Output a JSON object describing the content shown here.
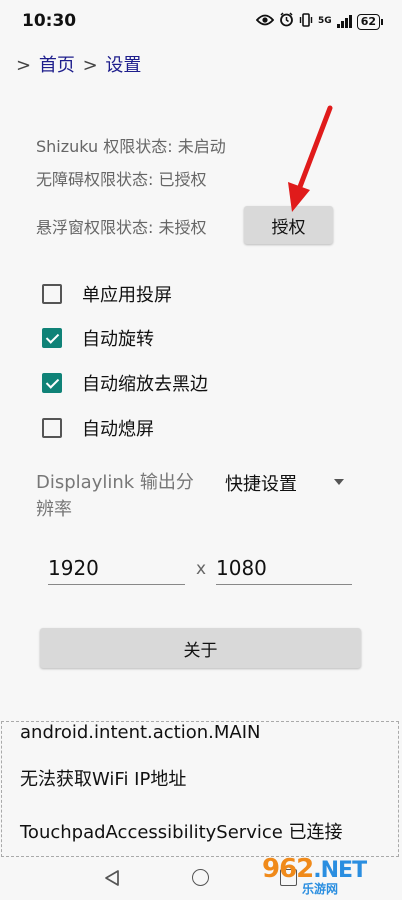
{
  "status_bar": {
    "time": "10:30",
    "network": "5G",
    "battery": "62",
    "icons": [
      "eye-icon",
      "alarm-icon",
      "vibrate-icon",
      "signal-icon",
      "battery-icon"
    ]
  },
  "breadcrumb": {
    "separator": ">",
    "home": "首页",
    "current": "设置"
  },
  "permissions": {
    "shizuku": "Shizuku 权限状态: 未启动",
    "accessibility": "无障碍权限状态: 已授权",
    "overlay": "悬浮窗权限状态: 未授权",
    "grant_label": "授权"
  },
  "options": [
    {
      "label": "单应用投屏",
      "checked": false
    },
    {
      "label": "自动旋转",
      "checked": true
    },
    {
      "label": "自动缩放去黑边",
      "checked": true
    },
    {
      "label": "自动熄屏",
      "checked": false
    }
  ],
  "displaylink": {
    "label": "Displaylink 输出分辨率",
    "selected": "快捷设置",
    "width": "1920",
    "separator": "x",
    "height": "1080"
  },
  "about_label": "关于",
  "log": [
    "android.intent.action.MAIN",
    "无法获取WiFi IP地址",
    "TouchpadAccessibilityService 已连接"
  ],
  "watermark": {
    "logo_num": "962",
    "logo_net": ".NET",
    "sub": "乐游网"
  },
  "colors": {
    "accent": "#0f8277",
    "breadcrumb": "#1e1e8c",
    "arrow": "#e01b1b",
    "button_bg": "#d9d9d9"
  }
}
